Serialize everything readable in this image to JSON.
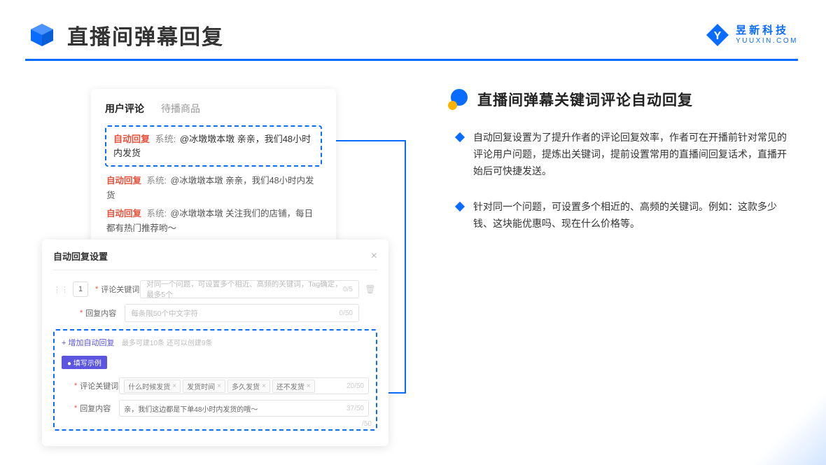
{
  "header": {
    "title": "直播间弹幕回复",
    "logo_cn": "昱新科技",
    "logo_en": "YUUXIN.COM"
  },
  "comments": {
    "tab_active": "用户评论",
    "tab_other": "待播商品",
    "highlight_tag": "自动回复",
    "highlight_sys": "系统:",
    "highlight_text": "@冰墩墩本墩 亲亲，我们48小时内发货",
    "line2_tag": "自动回复",
    "line2_sys": "系统:",
    "line2_text": "@冰墩墩本墩 亲亲，我们48小时内发货",
    "line3_tag": "自动回复",
    "line3_sys": "系统:",
    "line3_text": "@冰墩墩本墩 关注我们的店铺，每日都有热门推荐哟～"
  },
  "settings": {
    "title": "自动回复设置",
    "row_num": "1",
    "label_keyword": "评论关键词",
    "placeholder_keyword": "对同一个问题，可设置多个相近、高频的关键词，Tag确定，最多5个",
    "count_keyword": "0/5",
    "label_content": "回复内容",
    "placeholder_content": "每条限50个中文字符",
    "count_content": "0/50",
    "add_link": "+ 增加自动回复",
    "add_hint": "最多可建10条 还可以创建9条",
    "example_label": "● 填写示例",
    "ex_label_keyword": "评论关键词",
    "ex_tags": [
      "什么时候发货",
      "发货时间",
      "多久发货",
      "还不发货"
    ],
    "ex_count_keyword": "20/50",
    "ex_label_content": "回复内容",
    "ex_content": "亲，我们这边都是下单48小时内发货的哦～",
    "ex_count_content": "37/50",
    "stray_count": "/50"
  },
  "right": {
    "heading": "直播间弹幕关键词评论自动回复",
    "bullet1": "自动回复设置为了提升作者的评论回复效率，作者可在开播前针对常见的评论用户问题，提炼出关键词，提前设置常用的直播间回复话术，直播开始后可快捷发送。",
    "bullet2": "针对同一个问题，可设置多个相近的、高频的关键词。例如：这款多少钱、这块能优惠吗、现在什么价格等。"
  }
}
